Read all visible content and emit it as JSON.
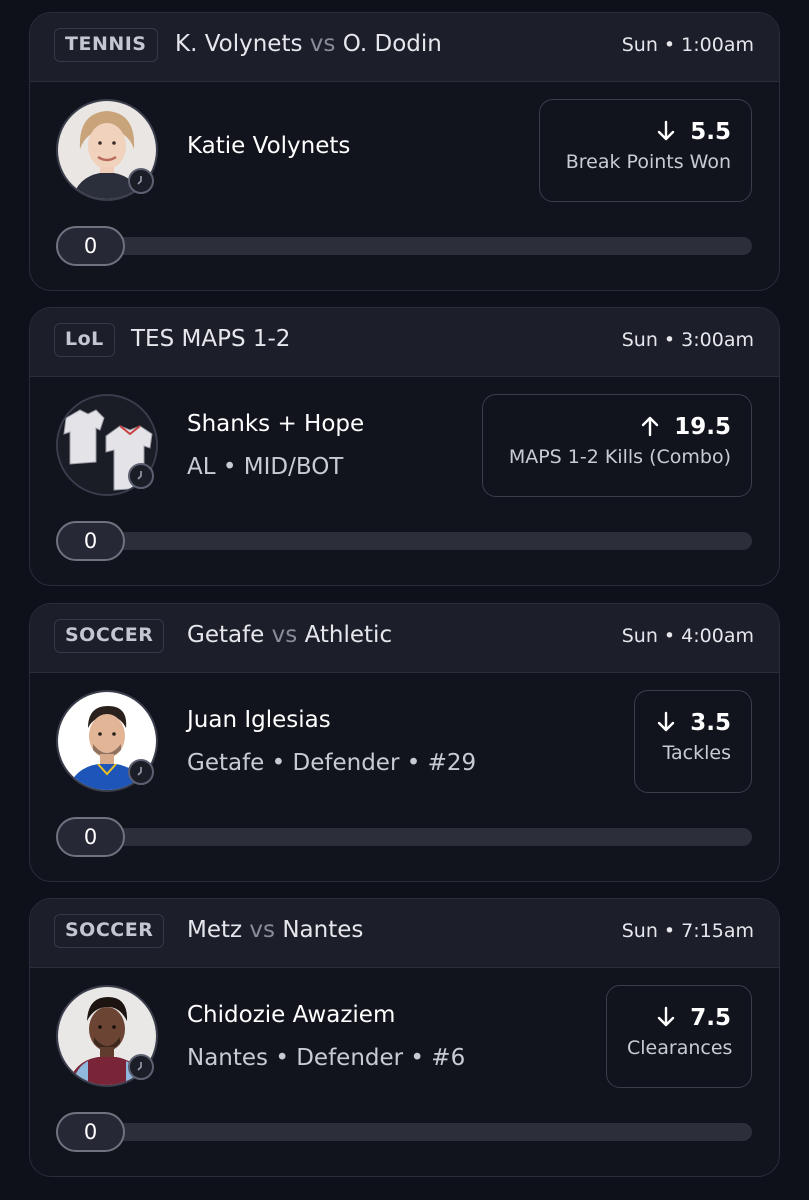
{
  "props": [
    {
      "sport": "TENNIS",
      "team_a": "K. Volynets",
      "vs": "vs",
      "team_b": "O. Dodin",
      "time": "Sun • 1:00am",
      "player": "Katie Volynets",
      "details": "",
      "direction": "down",
      "line": "5.5",
      "stat": "Break Points Won",
      "progress": "0"
    },
    {
      "sport": "LoL",
      "title": "TES MAPS 1-2",
      "time": "Sun • 3:00am",
      "player": "Shanks + Hope",
      "details": "AL • MID/BOT",
      "direction": "up",
      "line": "19.5",
      "stat": "MAPS 1-2 Kills (Combo)",
      "progress": "0"
    },
    {
      "sport": "SOCCER",
      "team_a": "Getafe",
      "vs": "vs",
      "team_b": "Athletic",
      "time": "Sun • 4:00am",
      "player": "Juan Iglesias",
      "details": "Getafe • Defender • #29",
      "direction": "down",
      "line": "3.5",
      "stat": "Tackles",
      "progress": "0"
    },
    {
      "sport": "SOCCER",
      "team_a": "Metz",
      "vs": "vs",
      "team_b": "Nantes",
      "time": "Sun • 7:15am",
      "player": "Chidozie Awaziem",
      "details": "Nantes • Defender • #6",
      "direction": "down",
      "line": "7.5",
      "stat": "Clearances",
      "progress": "0"
    }
  ],
  "colors": {
    "background": "#0f111a",
    "card": "#12141d",
    "header": "#1c1e29",
    "border": "#2a2d3a"
  }
}
